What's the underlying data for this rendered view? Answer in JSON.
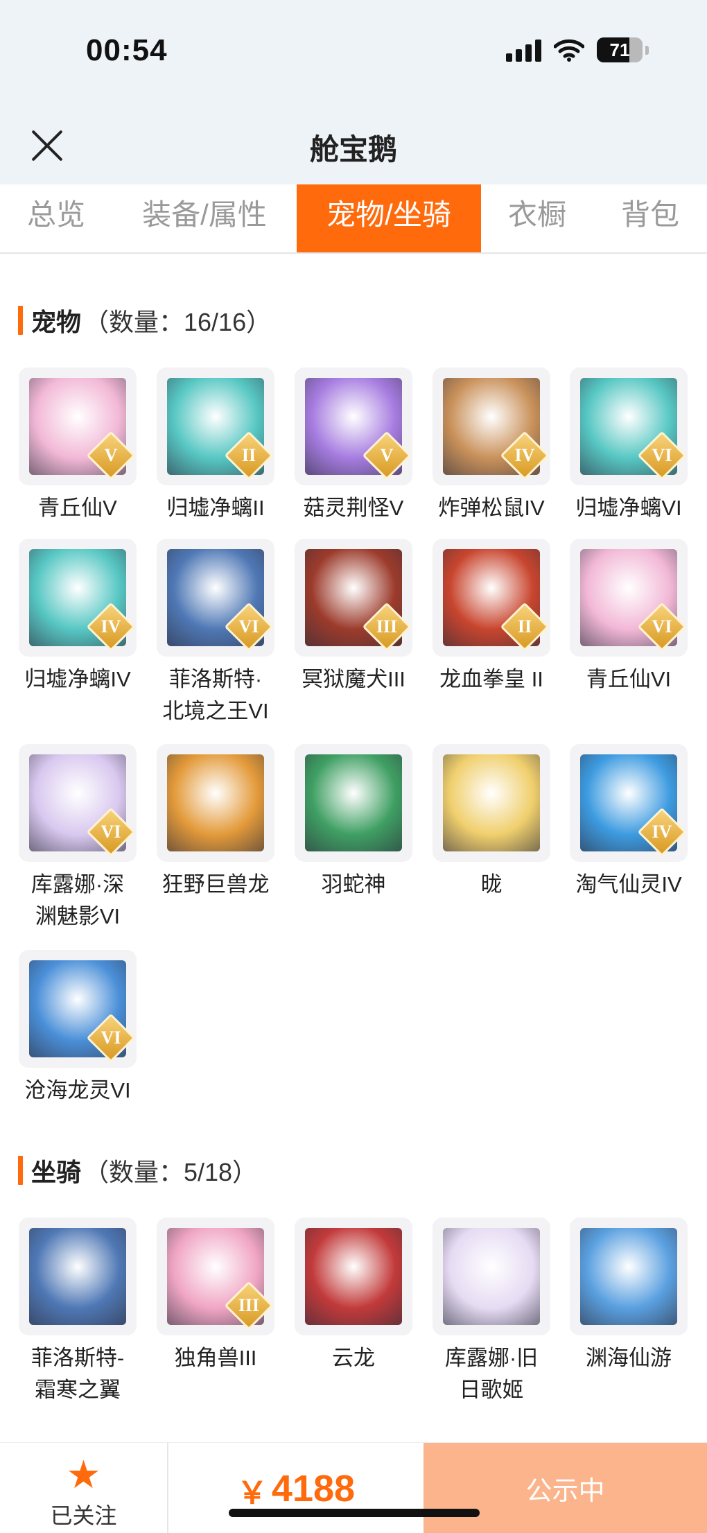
{
  "status_bar": {
    "time": "00:54",
    "battery": "71",
    "battery_level": 0.71
  },
  "header": {
    "title": "舱宝鹅"
  },
  "tabs": [
    {
      "label": "总览",
      "active": false
    },
    {
      "label": "装备/属性",
      "active": false
    },
    {
      "label": "宠物/坐骑",
      "active": true
    },
    {
      "label": "衣橱",
      "active": false
    },
    {
      "label": "背包",
      "active": false
    }
  ],
  "pets": {
    "title": "宠物",
    "count": "（数量：16/16）",
    "items": [
      {
        "line1": "青丘仙V",
        "line2": "",
        "badge": "V",
        "icon": "pink-fox-fairy-portrait",
        "color": "#f2b8d6"
      },
      {
        "line1": "归墟净螭II",
        "line2": "",
        "badge": "II",
        "icon": "teal-dragon-portrait",
        "color": "#57c7c3"
      },
      {
        "line1": "菇灵荆怪V",
        "line2": "",
        "badge": "V",
        "icon": "purple-mushroom-sprite-portrait",
        "color": "#a67ce0"
      },
      {
        "line1": "炸弹松鼠IV",
        "line2": "",
        "badge": "IV",
        "icon": "bomb-squirrel-portrait",
        "color": "#c9915a"
      },
      {
        "line1": "归墟净螭VI",
        "line2": "",
        "badge": "VI",
        "icon": "teal-dragon-portrait",
        "color": "#57c7c3"
      },
      {
        "line1": "归墟净螭IV",
        "line2": "",
        "badge": "IV",
        "icon": "teal-dragon-portrait",
        "color": "#57c7c3"
      },
      {
        "line1": "菲洛斯特·",
        "line2": "北境之王VI",
        "badge": "VI",
        "icon": "ice-dragon-king-portrait",
        "color": "#4f78b5"
      },
      {
        "line1": "冥狱魔犬III",
        "line2": "",
        "badge": "III",
        "icon": "hell-hound-portrait",
        "color": "#9c3b2c"
      },
      {
        "line1": "龙血拳皇 II",
        "line2": "",
        "badge": "II",
        "icon": "bull-fighter-portrait",
        "color": "#c8452e"
      },
      {
        "line1": "青丘仙VI",
        "line2": "",
        "badge": "VI",
        "icon": "pink-fox-fairy-portrait",
        "color": "#f2b8d6"
      },
      {
        "line1": "库露娜·深",
        "line2": "渊魅影VI",
        "badge": "VI",
        "icon": "kuluna-abyss-portrait",
        "color": "#d9c8ef"
      },
      {
        "line1": "狂野巨兽龙",
        "line2": "",
        "badge": "",
        "icon": "wild-beast-dragon-portrait",
        "color": "#e39a3a"
      },
      {
        "line1": "羽蛇神",
        "line2": "",
        "badge": "",
        "icon": "feathered-serpent-portrait",
        "color": "#3f9f63"
      },
      {
        "line1": "昽",
        "line2": "",
        "badge": "",
        "icon": "golden-deity-portrait",
        "color": "#f0cf6d"
      },
      {
        "line1": "淘气仙灵IV",
        "line2": "",
        "badge": "IV",
        "icon": "blue-spirit-dog-portrait",
        "color": "#3d9be0"
      },
      {
        "line1": "沧海龙灵VI",
        "line2": "",
        "badge": "VI",
        "icon": "blue-dragon-spirit-portrait",
        "color": "#4a8fd8"
      }
    ]
  },
  "mounts": {
    "title": "坐骑",
    "count": "（数量：5/18）",
    "items": [
      {
        "line1": "菲洛斯特-",
        "line2": "霜寒之翼",
        "badge": "",
        "icon": "frost-wing-mount-portrait",
        "color": "#4f78b5"
      },
      {
        "line1": "独角兽III",
        "line2": "",
        "badge": "III",
        "icon": "unicorn-portrait",
        "color": "#f0a6c4"
      },
      {
        "line1": "云龙",
        "line2": "",
        "badge": "",
        "icon": "red-cloud-dragon-portrait",
        "color": "#c23a3a"
      },
      {
        "line1": "库露娜·旧",
        "line2": "日歌姬",
        "badge": "",
        "icon": "kuluna-songstress-portrait",
        "color": "#e6dbf3"
      },
      {
        "line1": "渊海仙游",
        "line2": "",
        "badge": "",
        "icon": "abyss-sea-traveler-portrait",
        "color": "#5aa0e0"
      }
    ]
  },
  "footer": {
    "follow_label": "已关注",
    "currency": "￥",
    "price": "4188",
    "status_button": "公示中"
  }
}
